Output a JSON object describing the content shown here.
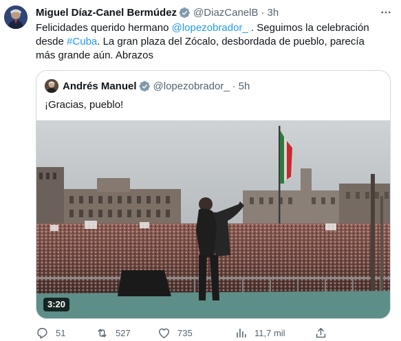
{
  "tweet": {
    "author_name": "Miguel Díaz-Canel Bermúdez",
    "handle": "@DiazCanelB",
    "separator": "·",
    "time": "3h",
    "text_parts": {
      "p1": "Felicidades querido hermano ",
      "mention": "@lopezobrador_",
      "p2": " . Seguimos la celebración desde ",
      "hashtag": "#Cuba",
      "p3": ". La gran plaza del Zócalo, desbordada de pueblo, parecía más grande aún. Abrazos"
    },
    "more_icon": "more-horizontal-icon"
  },
  "quote": {
    "author_name": "Andrés Manuel",
    "handle": "@lopezobrador_",
    "separator": "·",
    "time": "5h",
    "text": "¡Gracias, pueblo!",
    "video_duration": "3:20"
  },
  "actions": {
    "replies": "51",
    "retweets": "527",
    "likes": "735",
    "views": "11,7 mil"
  },
  "colors": {
    "link": "#1d9bf0",
    "verified": "#829aab",
    "muted": "#536471",
    "text": "#0f1419"
  }
}
